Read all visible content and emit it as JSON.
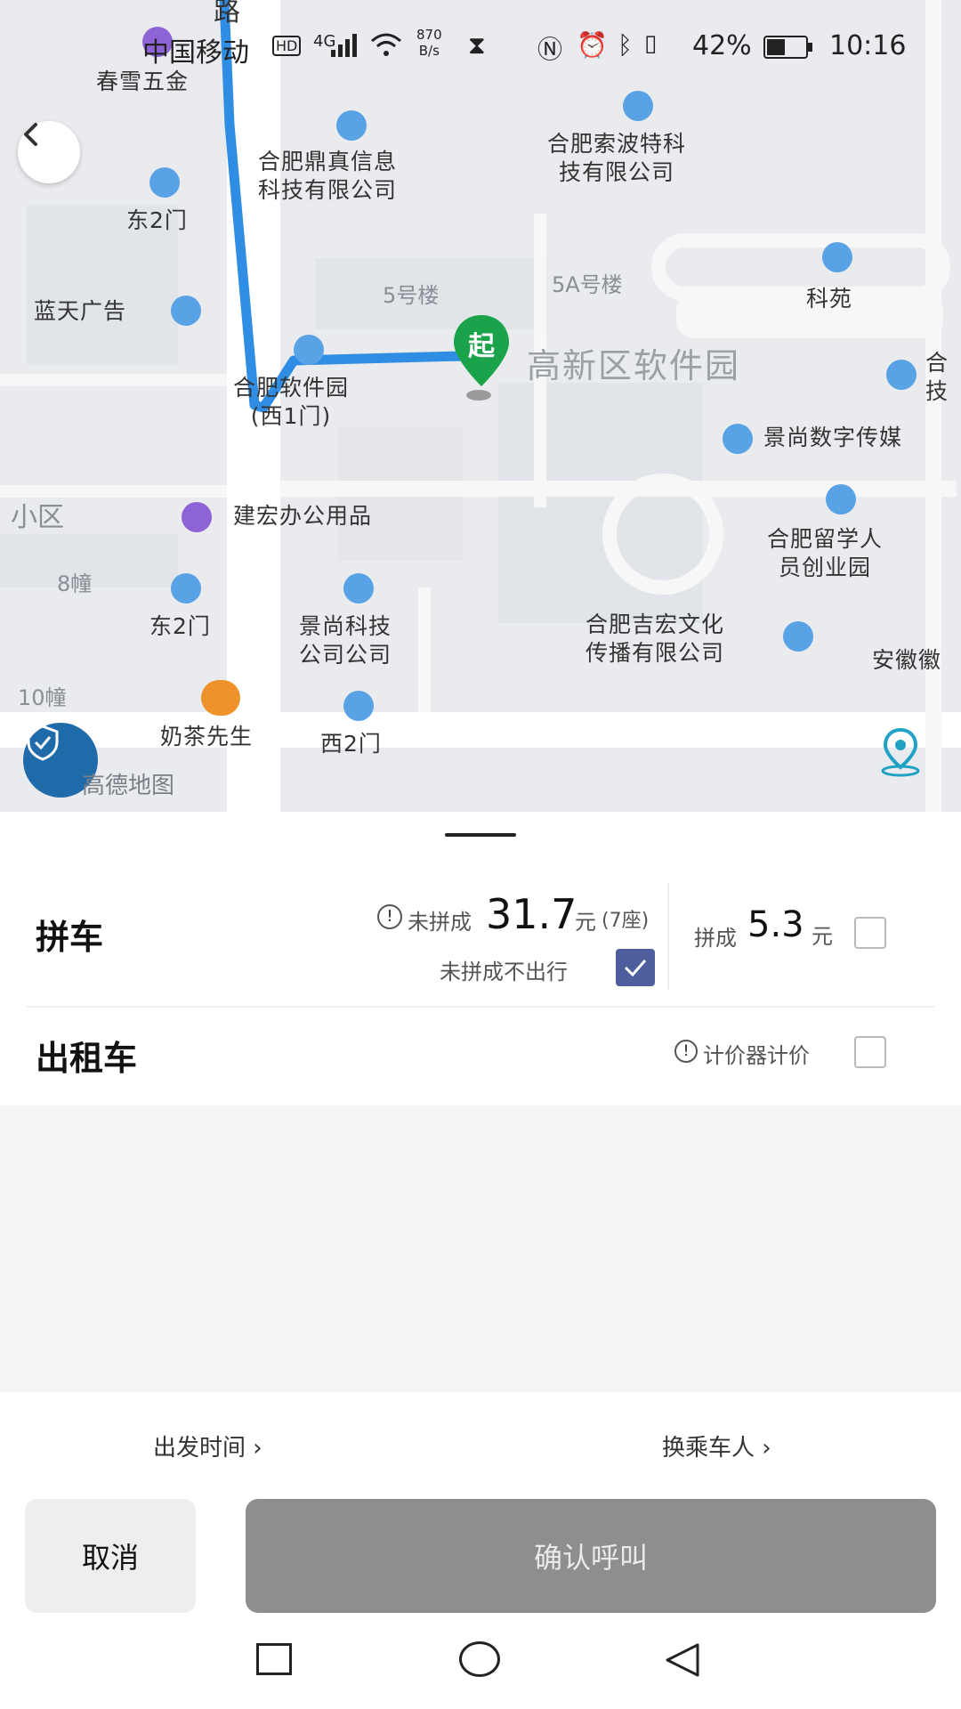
{
  "status_bar": {
    "carrier": "中国移动",
    "hd": "HD",
    "signal": "4G",
    "speed_top": "870",
    "speed_bottom": "B/s",
    "battery_percent": "42%",
    "time": "10:16"
  },
  "map": {
    "road_label": "路",
    "start_marker": "起",
    "start_name": "高新区软件园",
    "brand": "高德地图",
    "pois": [
      {
        "label": "春雪五金"
      },
      {
        "label": "合肥鼎真信息\n科技有限公司"
      },
      {
        "label": "合肥索波特科\n技有限公司"
      },
      {
        "label": "东2门"
      },
      {
        "label": "蓝天广告"
      },
      {
        "label": "合肥软件园\n(西1门)"
      },
      {
        "label": "科苑"
      },
      {
        "label": "景尚数字传媒"
      },
      {
        "label": "建宏办公用品"
      },
      {
        "label": "合肥留学人\n员创业园"
      },
      {
        "label": "东2门"
      },
      {
        "label": "景尚科技\n公司公司"
      },
      {
        "label": "合肥吉宏文化\n传播有限公司"
      },
      {
        "label": "奶茶先生"
      },
      {
        "label": "西2门"
      },
      {
        "label": "安徽徽"
      },
      {
        "label": "合\n技"
      }
    ],
    "buildings": [
      "5号楼",
      "5A号楼",
      "小区",
      "8幢",
      "10幢"
    ],
    "colors": {
      "route": "#2f8de4",
      "start_marker": "#1aa34a",
      "poi_pin": "#5aa2e6"
    }
  },
  "options": {
    "carpool": {
      "title": "拼车",
      "info_prefix": "未拼成",
      "price": "31.7",
      "unit": "元",
      "seats": "(7座)",
      "no_trip_label": "未拼成不出行",
      "no_trip_checked": true,
      "success_prefix": "拼成",
      "success_price": "5.3",
      "success_unit": "元",
      "success_checked": false
    },
    "taxi": {
      "title": "出租车",
      "meter_label": "计价器计价",
      "checked": false
    }
  },
  "footer": {
    "depart_time": "出发时间",
    "change_passenger": "换乘车人",
    "cancel": "取消",
    "confirm": "确认呼叫"
  }
}
